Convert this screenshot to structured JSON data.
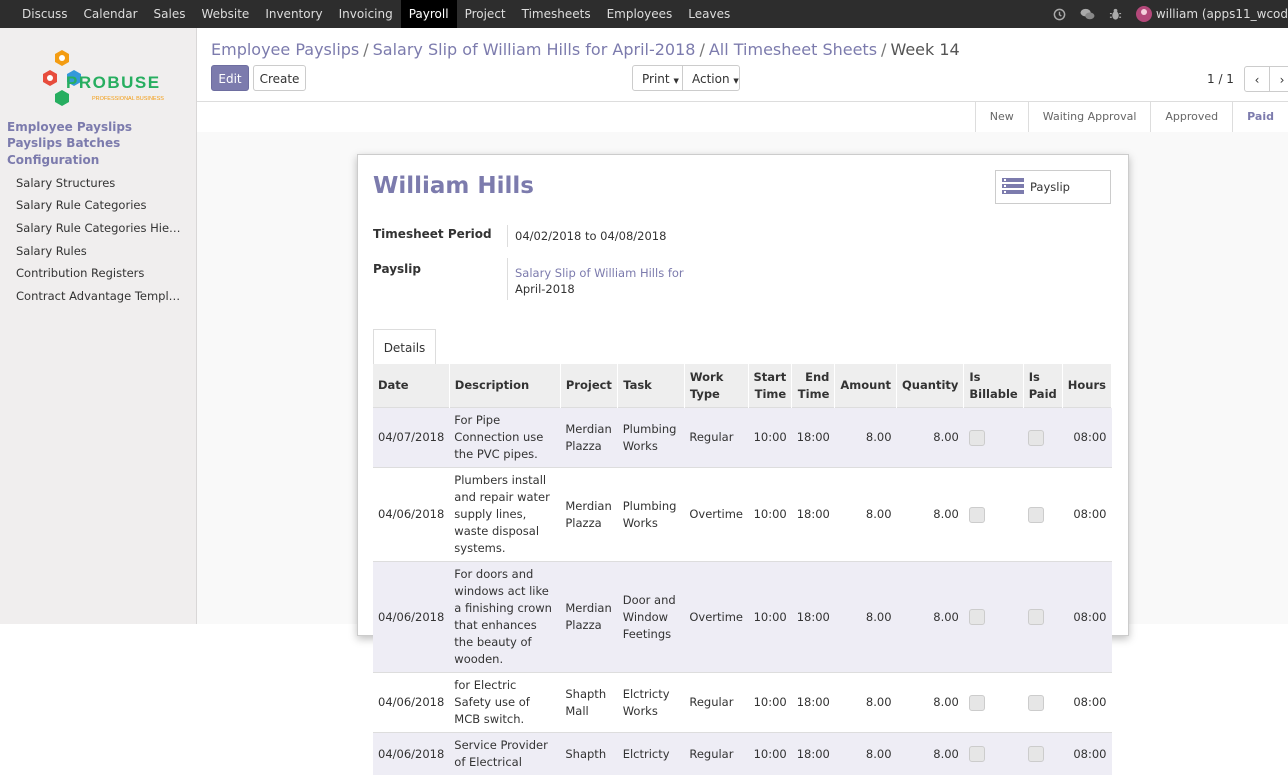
{
  "topbar": {
    "menu": [
      "Discuss",
      "Calendar",
      "Sales",
      "Website",
      "Inventory",
      "Invoicing",
      "Payroll",
      "Project",
      "Timesheets",
      "Employees",
      "Leaves"
    ],
    "active": "Payroll",
    "user_label": "william (apps11_wcod"
  },
  "sidebar": {
    "logo": {
      "brand": "PROBUSE",
      "tagline": "PROFESSIONAL BUSINESS"
    },
    "heads": [
      "Employee Payslips",
      "Payslips Batches",
      "Configuration"
    ],
    "items": [
      "Salary Structures",
      "Salary Rule Categories",
      "Salary Rule Categories Hie…",
      "Salary Rules",
      "Contribution Registers",
      "Contract Advantage Templ…"
    ]
  },
  "breadcrumb": {
    "items": [
      "Employee Payslips",
      "Salary Slip of William Hills for April-2018",
      "All Timesheet Sheets"
    ],
    "current": "Week 14",
    "sep": "/"
  },
  "buttons": {
    "edit": "Edit",
    "create": "Create",
    "print": "Print",
    "action": "Action"
  },
  "pager": {
    "value": "1 / 1"
  },
  "stages": {
    "items": [
      "New",
      "Waiting Approval",
      "Approved",
      "Paid"
    ],
    "current": "Paid"
  },
  "form": {
    "employee": "William Hills",
    "smart_button": "Payslip",
    "period_label": "Timesheet Period",
    "period_value": "04/02/2018 to 04/08/2018",
    "payslip_label": "Payslip",
    "payslip_value_line1": "Salary Slip of William Hills for",
    "payslip_value_line2": "April-2018"
  },
  "tabs": [
    "Details"
  ],
  "table": {
    "headers": [
      "Date",
      "Description",
      "Project",
      "Task",
      "Work Type",
      "Start Time",
      "End Time",
      "Amount",
      "Quantity",
      "Is Billable",
      "Is Paid",
      "Hours"
    ],
    "rows": [
      {
        "date": "04/07/2018",
        "description": "For Pipe Connection use the PVC pipes.",
        "project": "Merdian Plazza",
        "task": "Plumbing Works",
        "work_type": "Regular",
        "start": "10:00",
        "end": "18:00",
        "amount": "8.00",
        "quantity": "8.00",
        "hours": "08:00"
      },
      {
        "date": "04/06/2018",
        "description": "Plumbers install and repair water supply lines, waste disposal systems.",
        "project": "Merdian Plazza",
        "task": "Plumbing Works",
        "work_type": "Overtime",
        "start": "10:00",
        "end": "18:00",
        "amount": "8.00",
        "quantity": "8.00",
        "hours": "08:00"
      },
      {
        "date": "04/06/2018",
        "description": "For doors and windows act like a finishing crown that enhances the beauty of wooden.",
        "project": "Merdian Plazza",
        "task": "Door and Window Feetings",
        "work_type": "Overtime",
        "start": "10:00",
        "end": "18:00",
        "amount": "8.00",
        "quantity": "8.00",
        "hours": "08:00"
      },
      {
        "date": "04/06/2018",
        "description": "for Electric Safety use of MCB switch.",
        "project": "Shapth Mall",
        "task": "Elctricty Works",
        "work_type": "Regular",
        "start": "10:00",
        "end": "18:00",
        "amount": "8.00",
        "quantity": "8.00",
        "hours": "08:00"
      },
      {
        "date": "04/06/2018",
        "description": "Service Provider of Electrical",
        "project": "Shapth",
        "task": "Elctricty",
        "work_type": "Regular",
        "start": "10:00",
        "end": "18:00",
        "amount": "8.00",
        "quantity": "8.00",
        "hours": "08:00"
      }
    ]
  }
}
